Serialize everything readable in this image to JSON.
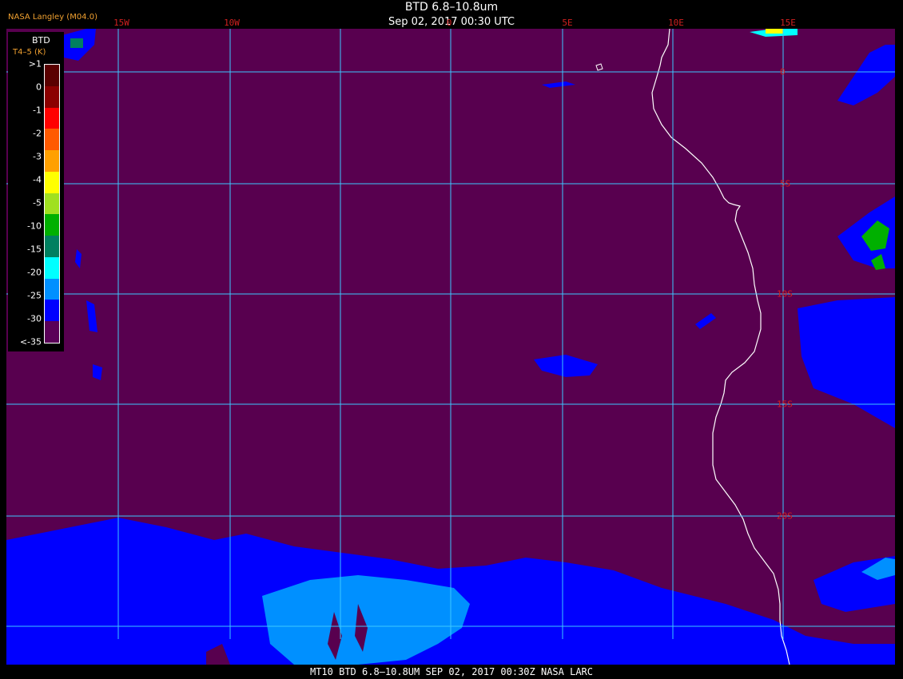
{
  "header": {
    "title": "BTD 6.8–10.8um",
    "datetime": "Sep 02, 2017 00:30 UTC",
    "credit": "NASA Langley (M04.0)"
  },
  "grid": {
    "lon_labels": [
      "15W",
      "10W",
      "0",
      "5E",
      "10E",
      "15E"
    ],
    "lat_labels": [
      "0",
      "5S",
      "10S",
      "15S",
      "20S"
    ]
  },
  "legend": {
    "title": "BTD",
    "subtitle": "T4–5 (K)",
    "ticks": [
      ">1",
      "0",
      "-1",
      "-2",
      "-3",
      "-4",
      "-5",
      "-10",
      "-15",
      "-20",
      "-25",
      "-30",
      "<-35"
    ],
    "colors": [
      "#5a0000",
      "#8b0000",
      "#ff0000",
      "#ff5a00",
      "#ffa000",
      "#ffff00",
      "#a0e020",
      "#00b000",
      "#008060",
      "#00ffff",
      "#0090ff",
      "#0000ff",
      "#5a0058"
    ]
  },
  "colors": {
    "background": "#58004f",
    "grid": "#3cc8ff",
    "coast": "#ffffff",
    "cloud_dark": "#0000ff",
    "cloud_light": "#0090ff"
  },
  "footer": {
    "text": "MT10  BTD 6.8–10.8UM   SEP 02, 2017 00:30Z   NASA LARC"
  }
}
